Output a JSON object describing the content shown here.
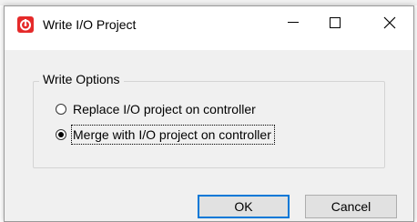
{
  "window": {
    "title": "Write I/O Project"
  },
  "titlebar": {
    "icons": [
      "app-logo-icon",
      "minimize-icon",
      "maximize-icon",
      "close-icon"
    ]
  },
  "group": {
    "label": "Write Options"
  },
  "options": [
    {
      "label": "Replace I/O project on controller",
      "selected": false
    },
    {
      "label": "Merge with I/O project on controller",
      "selected": true
    }
  ],
  "buttons": {
    "ok": "OK",
    "cancel": "Cancel"
  },
  "colors": {
    "app_icon": "#e52a2a",
    "default_button_border": "#0078d7",
    "dialog_bg": "#f0f0f0"
  }
}
